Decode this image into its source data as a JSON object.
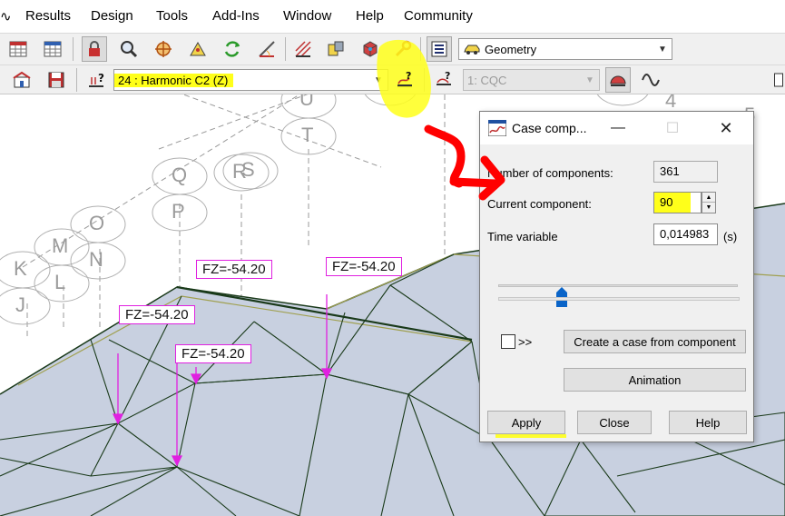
{
  "menu": {
    "items": [
      "Results",
      "Design",
      "Tools",
      "Add-Ins",
      "Window",
      "Help",
      "Community"
    ]
  },
  "toolbar": {
    "geometry_combo": "Geometry",
    "case_combo": "24 : Harmonic C2 (Z)",
    "cqc_combo": "1: CQC"
  },
  "viewport": {
    "node_labels": [
      "U",
      "T",
      "Q",
      "P",
      "R",
      "S",
      "O",
      "N",
      "M",
      "L",
      "K",
      "J",
      "4",
      "5"
    ],
    "load_labels": [
      "FZ=-54.20",
      "FZ=-54.20",
      "FZ=-54.20",
      "FZ=-54.20"
    ]
  },
  "dialog": {
    "title": "Case comp...",
    "number_of_components_label": "Number of components:",
    "number_of_components_value": "361",
    "current_component_label": "Current component:",
    "current_component_value": "90",
    "time_variable_label": "Time variable",
    "time_variable_value": "0,014983",
    "time_unit": "(s)",
    "slider_fraction": 0.25,
    "expand_label": ">>",
    "create_case_button": "Create a case from component",
    "animation_button": "Animation",
    "apply_button": "Apply",
    "close_button": "Close",
    "help_button": "Help"
  },
  "colors": {
    "highlight": "#ffff1a",
    "load_label_border": "#e020e0",
    "annotation_arrow": "#ff0000",
    "mesh_fill": "#c8d0e0",
    "mesh_line": "#1a3a1a",
    "slider_thumb": "#0a64c8"
  }
}
